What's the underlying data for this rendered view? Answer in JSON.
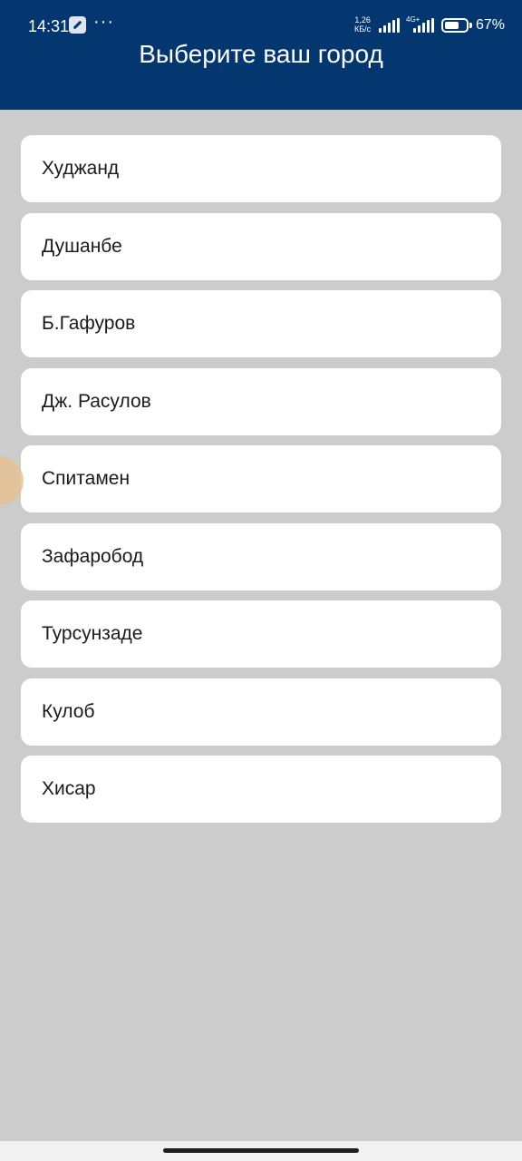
{
  "status_bar": {
    "time": "14:31",
    "network_speed": "1,26\nКБ/с",
    "network_type": "4G+",
    "battery_percent": "67%",
    "battery_level": 0.67
  },
  "header": {
    "title": "Выберите ваш город",
    "background_color": "#04376f"
  },
  "cities": [
    "Худжанд",
    "Душанбе",
    "Б.Гафуров",
    "Дж. Расулов",
    "Спитамен",
    "Зафаробод",
    "Турсунзаде",
    "Кулоб",
    "Хисар"
  ]
}
